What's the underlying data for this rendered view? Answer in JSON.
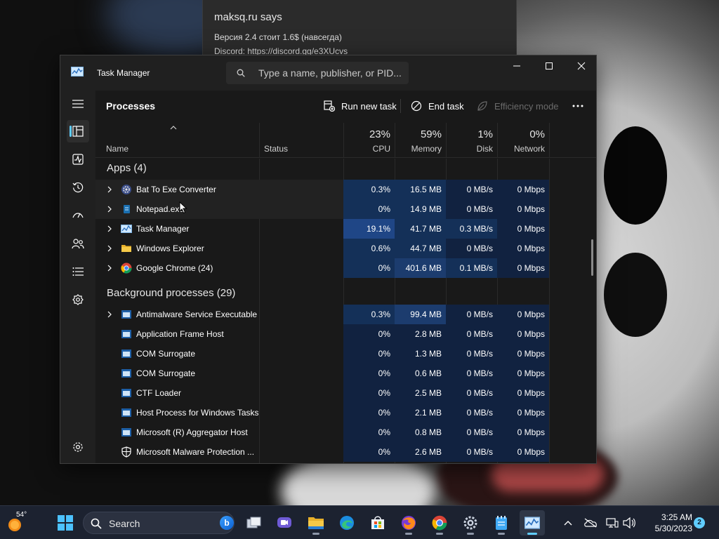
{
  "browser_alert": {
    "title": "maksq.ru says",
    "line1": "Версия 2.4 стоит 1.6$ (навсегда)",
    "line2": "Discord: https://discord.gg/e3XUcvs"
  },
  "window": {
    "title": "Task Manager",
    "search_placeholder": "Type a name, publisher, or PID...",
    "minimize_icon": "minimize-icon",
    "maximize_icon": "maximize-icon",
    "close_icon": "close-icon"
  },
  "rail": [
    "hamburger-icon",
    "processes-icon",
    "performance-icon",
    "app-history-icon",
    "startup-apps-icon",
    "users-icon",
    "details-icon",
    "services-icon",
    "settings-icon"
  ],
  "toolbar": {
    "page_title": "Processes",
    "run_new_task": "Run new task",
    "end_task": "End task",
    "efficiency_mode": "Efficiency mode"
  },
  "columns": {
    "name": "Name",
    "status": "Status",
    "cpu_pct": "23%",
    "cpu": "CPU",
    "memory_pct": "59%",
    "memory": "Memory",
    "disk_pct": "1%",
    "disk": "Disk",
    "network_pct": "0%",
    "network": "Network"
  },
  "sections": {
    "apps": "Apps (4)",
    "background": "Background processes (29)"
  },
  "apps": [
    {
      "name": "Bat To Exe Converter",
      "icon": "gear-badge-icon",
      "cpu": "0.3%",
      "memory": "16.5 MB",
      "disk": "0 MB/s",
      "network": "0 Mbps"
    },
    {
      "name": "Notepad.exe",
      "icon": "notepad-icon",
      "cpu": "0%",
      "memory": "14.9 MB",
      "disk": "0 MB/s",
      "network": "0 Mbps"
    },
    {
      "name": "Task Manager",
      "icon": "task-manager-icon",
      "cpu": "19.1%",
      "memory": "41.7 MB",
      "disk": "0.3 MB/s",
      "network": "0 Mbps"
    },
    {
      "name": "Windows Explorer",
      "icon": "folder-icon",
      "cpu": "0.6%",
      "memory": "44.7 MB",
      "disk": "0 MB/s",
      "network": "0 Mbps"
    },
    {
      "name": "Google Chrome (24)",
      "icon": "chrome-icon",
      "cpu": "0%",
      "memory": "401.6 MB",
      "disk": "0.1 MB/s",
      "network": "0 Mbps"
    }
  ],
  "background": [
    {
      "name": "Antimalware Service Executable",
      "icon": "process-icon",
      "cpu": "0.3%",
      "memory": "99.4 MB",
      "disk": "0 MB/s",
      "network": "0 Mbps"
    },
    {
      "name": "Application Frame Host",
      "icon": "process-icon",
      "cpu": "0%",
      "memory": "2.8 MB",
      "disk": "0 MB/s",
      "network": "0 Mbps"
    },
    {
      "name": "COM Surrogate",
      "icon": "process-icon",
      "cpu": "0%",
      "memory": "1.3 MB",
      "disk": "0 MB/s",
      "network": "0 Mbps"
    },
    {
      "name": "COM Surrogate",
      "icon": "process-icon",
      "cpu": "0%",
      "memory": "0.6 MB",
      "disk": "0 MB/s",
      "network": "0 Mbps"
    },
    {
      "name": "CTF Loader",
      "icon": "process-icon",
      "cpu": "0%",
      "memory": "2.5 MB",
      "disk": "0 MB/s",
      "network": "0 Mbps"
    },
    {
      "name": "Host Process for Windows Tasks",
      "icon": "process-icon",
      "cpu": "0%",
      "memory": "2.1 MB",
      "disk": "0 MB/s",
      "network": "0 Mbps"
    },
    {
      "name": "Microsoft (R) Aggregator Host",
      "icon": "process-icon",
      "cpu": "0%",
      "memory": "0.8 MB",
      "disk": "0 MB/s",
      "network": "0 Mbps"
    },
    {
      "name": "Microsoft Malware Protection ...",
      "icon": "shield-icon",
      "cpu": "0%",
      "memory": "2.6 MB",
      "disk": "0 MB/s",
      "network": "0 Mbps"
    }
  ],
  "taskbar": {
    "weather_temp": "54°",
    "search_label": "Search",
    "bing_letter": "b",
    "time": "3:25 AM",
    "date": "5/30/2023",
    "notification_count": "2"
  }
}
